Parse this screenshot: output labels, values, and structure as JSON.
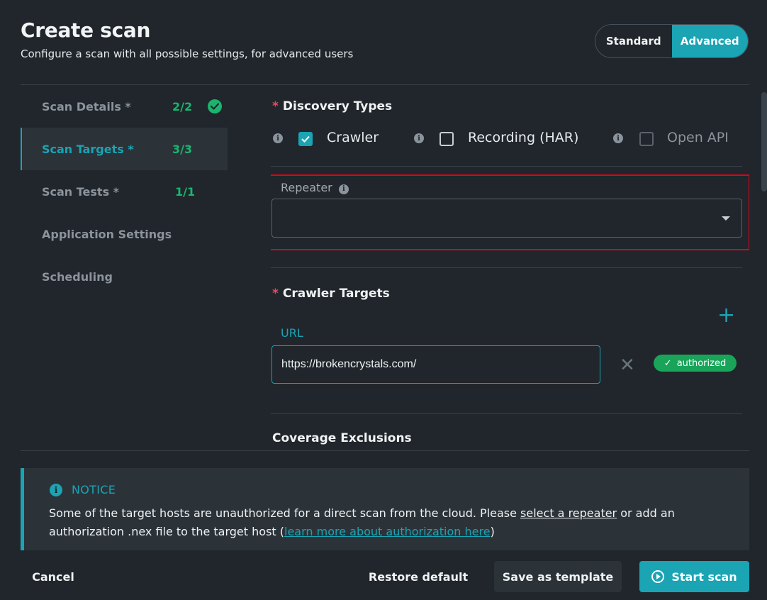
{
  "header": {
    "title": "Create scan",
    "subtitle": "Configure a scan with all possible settings, for advanced users"
  },
  "mode": {
    "options": [
      "Standard",
      "Advanced"
    ],
    "selected": "Advanced"
  },
  "sidebar": {
    "items": [
      {
        "label": "Scan Details *",
        "count": "2/2",
        "complete": true
      },
      {
        "label": "Scan Targets *",
        "count": "3/3",
        "active": true
      },
      {
        "label": "Scan Tests *",
        "count": "1/1"
      },
      {
        "label": "Application Settings",
        "count": ""
      },
      {
        "label": "Scheduling",
        "count": ""
      }
    ]
  },
  "discovery": {
    "title": "Discovery Types",
    "required_mark": "*",
    "types": [
      {
        "label": "Crawler",
        "checked": true,
        "disabled": false
      },
      {
        "label": "Recording (HAR)",
        "checked": false,
        "disabled": false
      },
      {
        "label": "Open API",
        "checked": false,
        "disabled": true
      }
    ]
  },
  "repeater": {
    "label": "Repeater",
    "value": ""
  },
  "crawler_targets": {
    "title": "Crawler Targets",
    "required_mark": "*",
    "url_label": "URL",
    "url_value": "https://brokencrystals.com/",
    "status_badge": "authorized"
  },
  "coverage": {
    "title": "Coverage Exclusions"
  },
  "notice": {
    "title": "NOTICE",
    "text_before": "Some of the target hosts are unauthorized for a direct scan from the cloud. Please ",
    "link_repeater": "select a repeater",
    "text_middle": " or add an authorization .nex file to the target host (",
    "link_learn": "learn more about authorization here",
    "text_after": ")"
  },
  "footer": {
    "cancel": "Cancel",
    "restore": "Restore default",
    "save_template": "Save as template",
    "start": "Start scan"
  },
  "colors": {
    "background": "#20262b",
    "accent": "#1aa4b4",
    "success": "#19b56e",
    "required": "#e8495e",
    "highlight_border": "#e0001b"
  }
}
